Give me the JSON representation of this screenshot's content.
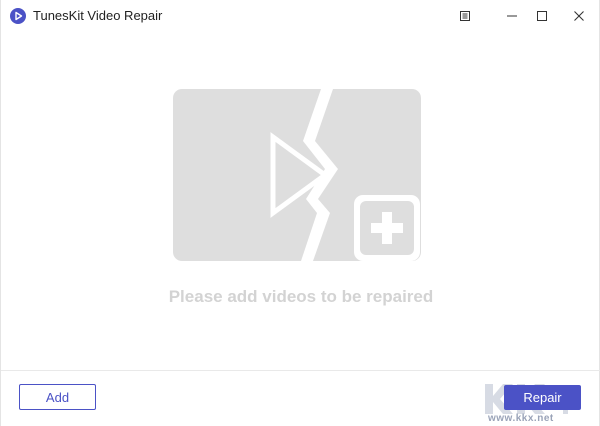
{
  "window": {
    "title": "TunesKit Video Repair",
    "icons": [
      "app-logo-icon",
      "menu-icon",
      "minimize-icon",
      "maximize-icon",
      "close-icon"
    ]
  },
  "main": {
    "drop_zone_icon": "broken-video-add-icon",
    "hint": "Please add videos to be repaired"
  },
  "footer": {
    "add_label": "Add",
    "repair_label": "Repair"
  },
  "watermark": {
    "url": "www.kkx.net"
  },
  "colors": {
    "accent": "#4b52c6",
    "placeholder_gray": "#dedede",
    "hint_text": "#d3d3d3"
  }
}
